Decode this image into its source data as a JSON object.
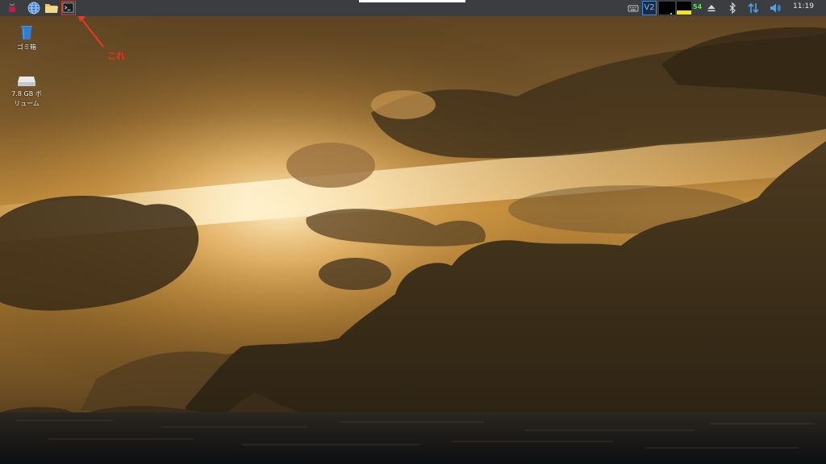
{
  "taskbar": {
    "launchers": [
      {
        "name": "raspberry-menu-icon"
      },
      {
        "name": "web-browser-icon"
      },
      {
        "name": "file-manager-icon"
      },
      {
        "name": "terminal-icon"
      }
    ],
    "tray": {
      "cpu_temperature": "54",
      "clock": "11:19",
      "vnc_label": "V2"
    }
  },
  "desktop": {
    "icons": [
      {
        "name": "trash",
        "label": "ゴミ箱"
      },
      {
        "name": "volume",
        "label_line1": "7.8 GB ボ",
        "label_line2": "リューム"
      }
    ]
  },
  "annotation": {
    "label": "これ",
    "color": "#ff2a1a"
  },
  "colors": {
    "taskbar_bg": "#3b3d40",
    "sky_glow": "#f3c57a",
    "sea": "#15161a"
  }
}
